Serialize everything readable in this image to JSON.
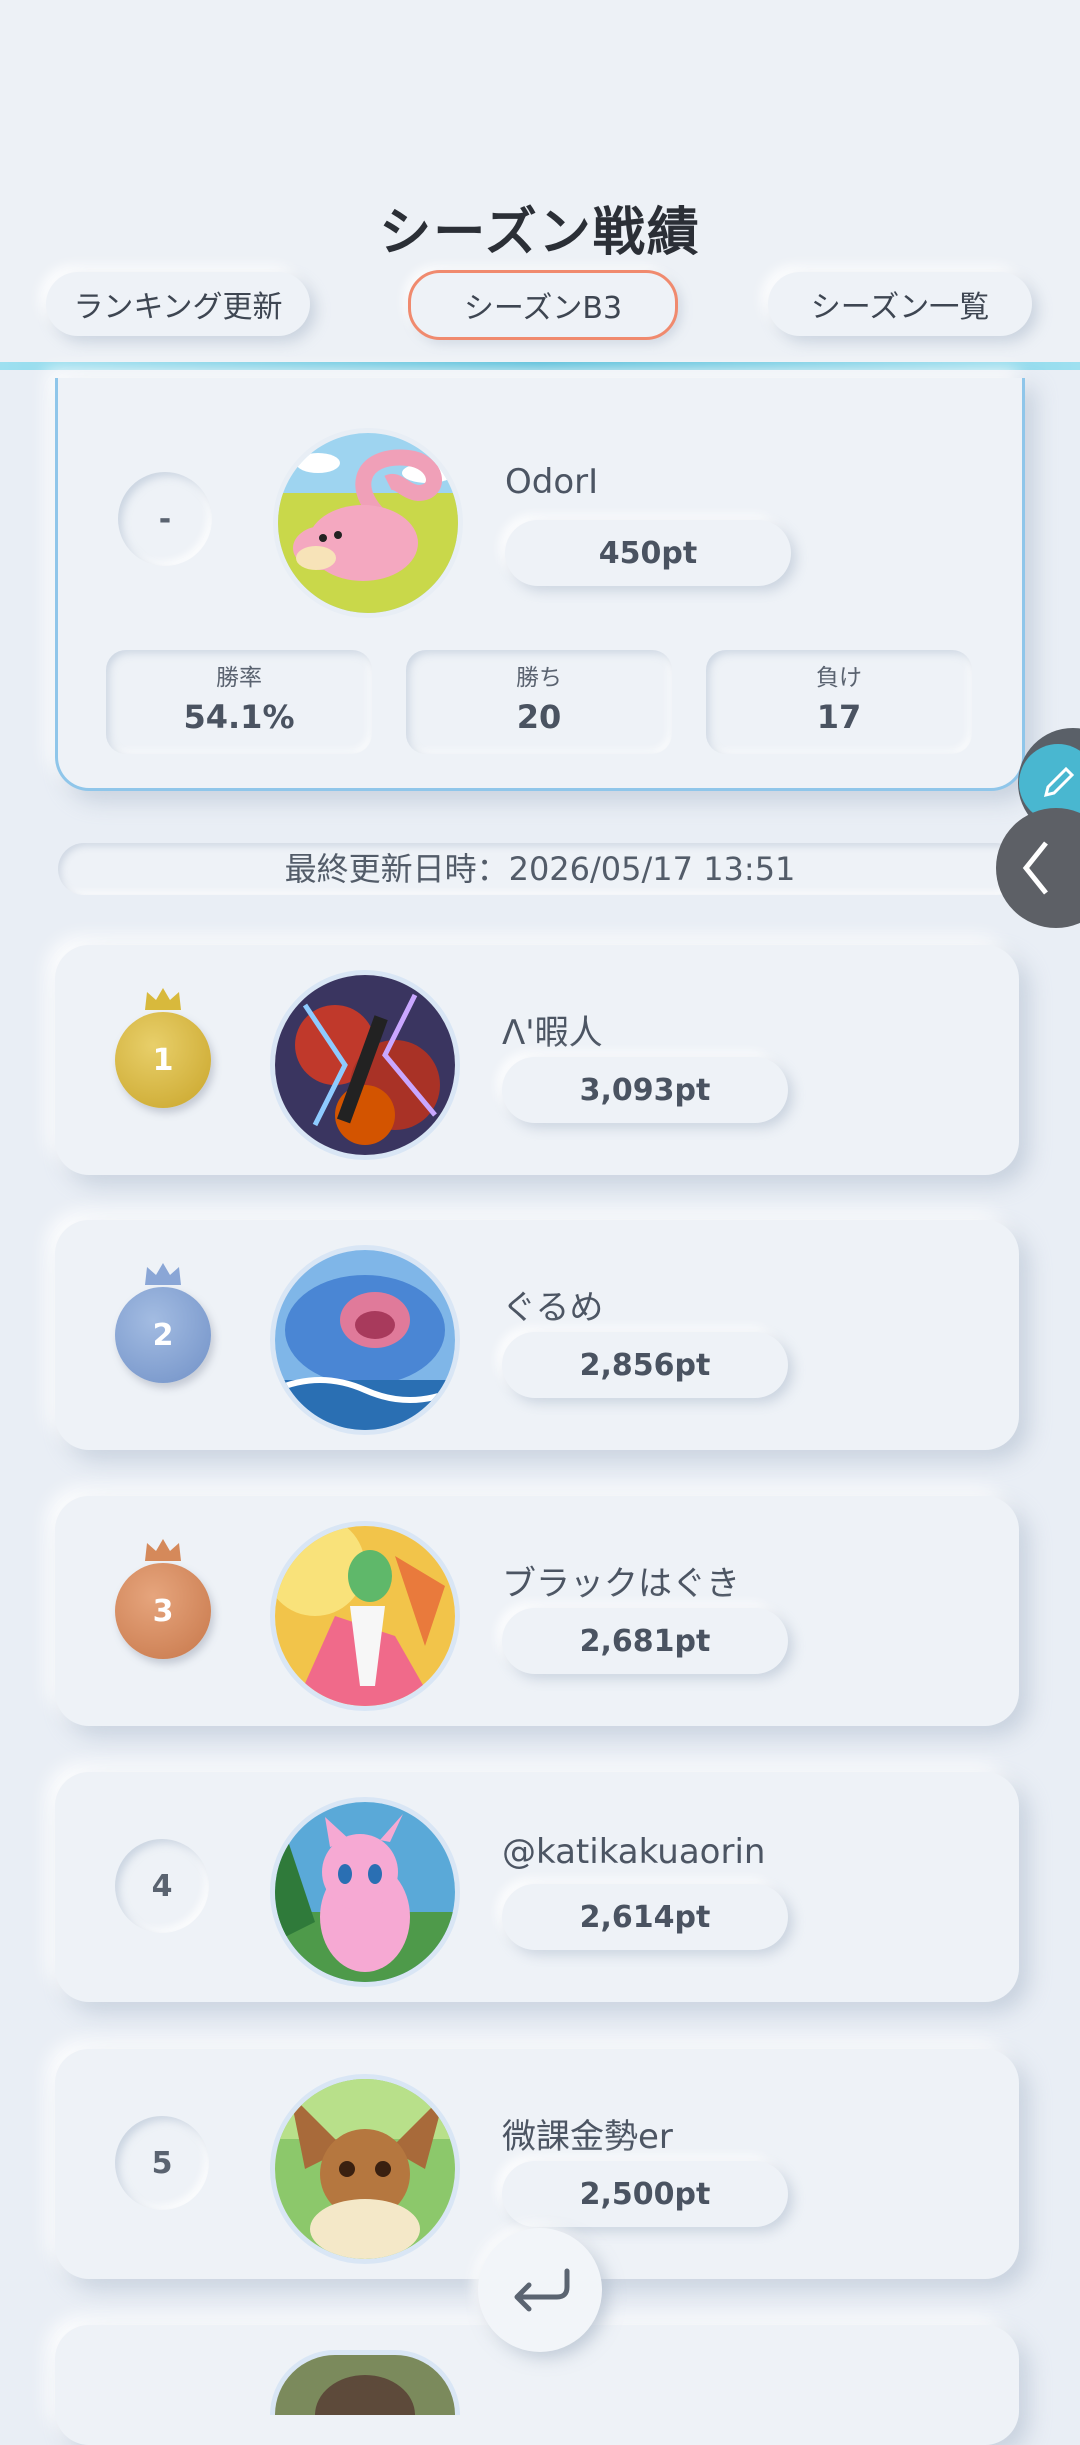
{
  "header": {
    "title": "シーズン戦績",
    "tabs": [
      {
        "label": "ランキング更新"
      },
      {
        "label": "シーズンB3"
      },
      {
        "label": "シーズン一覧"
      }
    ]
  },
  "my_record": {
    "rank": "-",
    "name": "OdorI",
    "points": "450pt",
    "stats": [
      {
        "label": "勝率",
        "value": "54.1%"
      },
      {
        "label": "勝ち",
        "value": "20"
      },
      {
        "label": "負け",
        "value": "17"
      }
    ]
  },
  "last_updated": "最終更新日時：2026/05/17 13:51",
  "ranking": [
    {
      "rank": "1",
      "name": "Λ'暇人",
      "points": "3,093pt",
      "medal_color": "#d8b93c"
    },
    {
      "rank": "2",
      "name": "ぐるめ",
      "points": "2,856pt",
      "medal_color": "#7f9fd1"
    },
    {
      "rank": "3",
      "name": "ブラックはぐき",
      "points": "2,681pt",
      "medal_color": "#d5895a"
    },
    {
      "rank": "4",
      "name": "@katikakuaorin",
      "points": "2,614pt"
    },
    {
      "rank": "5",
      "name": "微課金勢er",
      "points": "2,500pt"
    }
  ],
  "colors": {
    "accent": "#4ab9d6",
    "active_tab_border": "#f08a6e"
  },
  "icons": {
    "side_edit": "pencil-icon",
    "side_collapse": "chevron-left-icon",
    "return": "return-arrow-icon"
  }
}
